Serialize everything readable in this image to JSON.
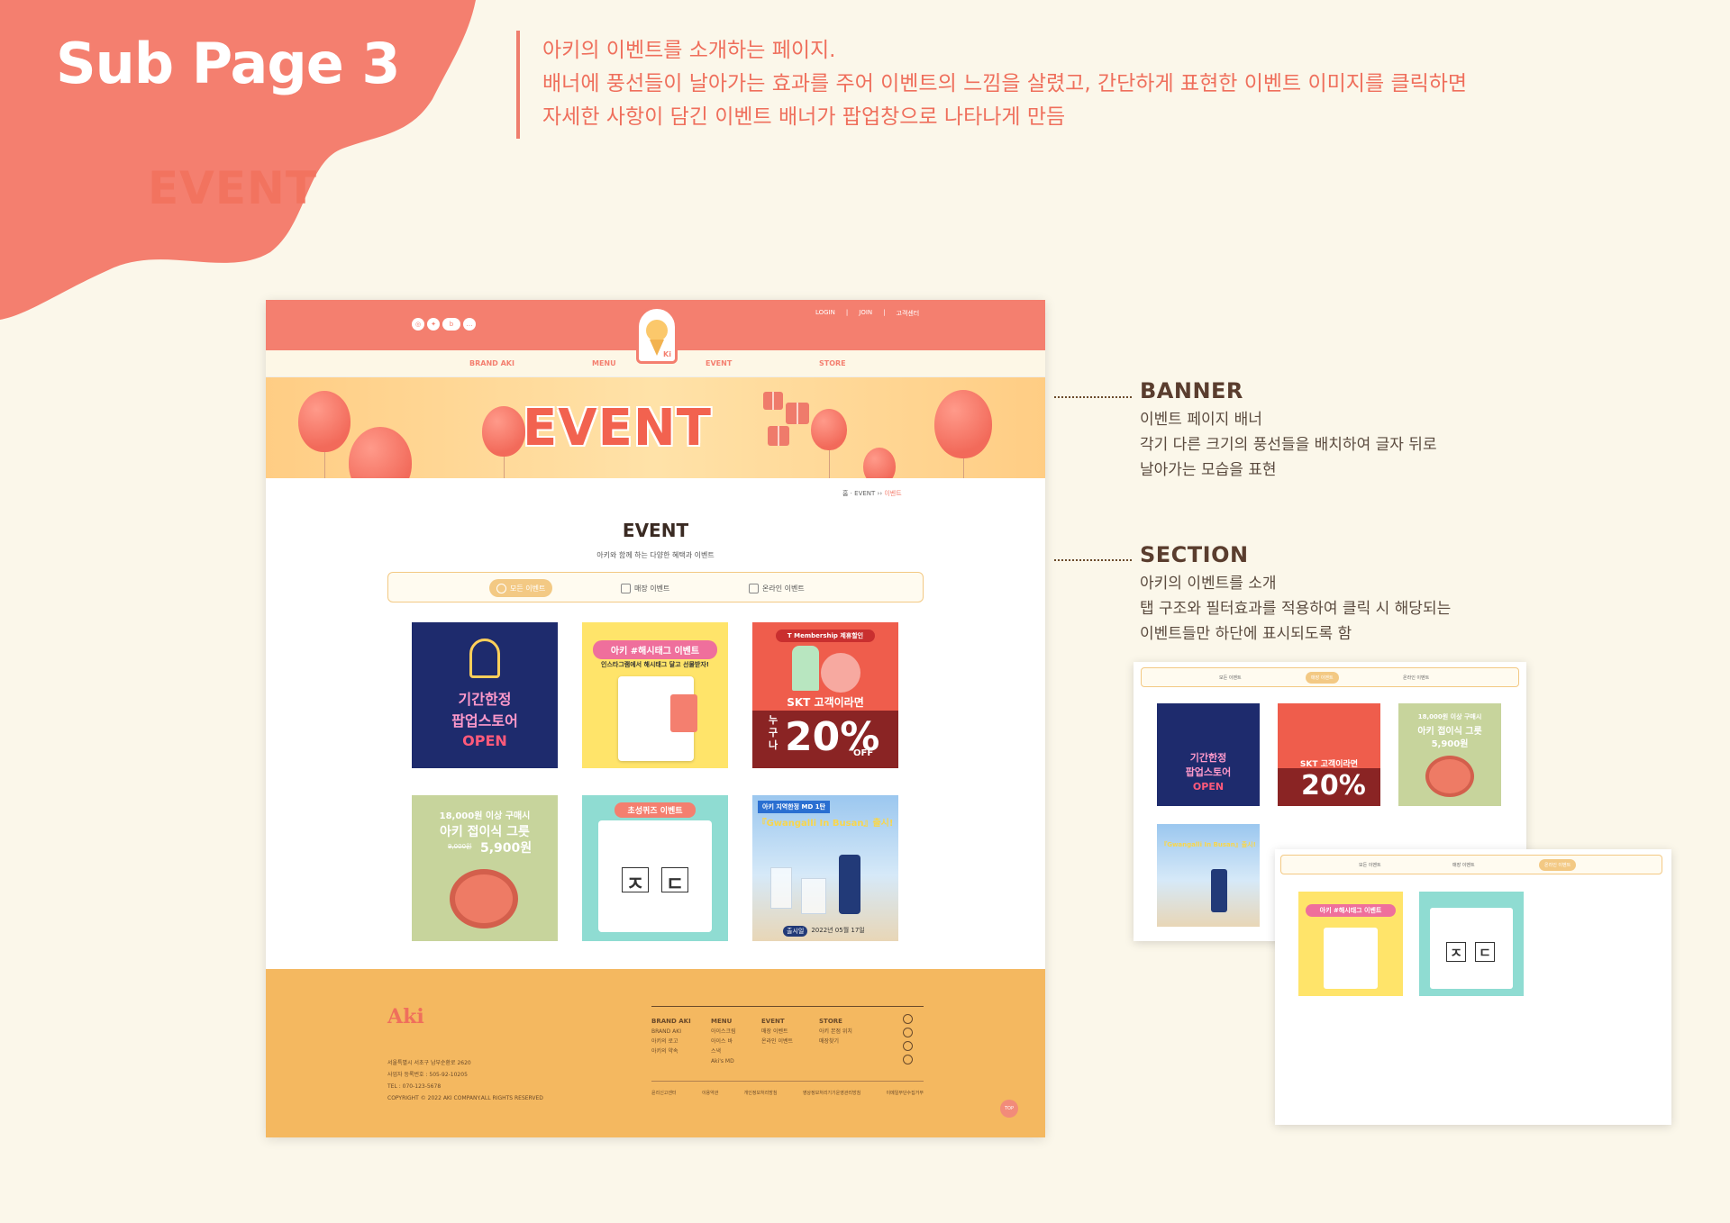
{
  "header": {
    "sub_title": "Sub Page 3",
    "page_name": "EVENT",
    "description": [
      "아키의 이벤트를 소개하는 페이지.",
      "배너에 풍선들이 날아가는 효과를 주어 이벤트의 느낌을 살렸고, 간단하게 표현한 이벤트 이미지를 클릭하면",
      "자세한 사항이 담긴 이벤트 배너가 팝업창으로 나타나게 만듬"
    ]
  },
  "site": {
    "util_links": [
      "LOGIN",
      "JOIN",
      "고객센터"
    ],
    "nav": [
      "BRAND AKI",
      "MENU",
      "EVENT",
      "STORE"
    ],
    "banner_title": "EVENT",
    "breadcrumb": {
      "home": "홈",
      "section": "EVENT",
      "current": "이벤트"
    },
    "section_title": "EVENT",
    "section_subtitle": "아키와 함께 하는 다양한 혜택과 이벤트",
    "tabs": [
      "모든 이벤트",
      "매장 이벤트",
      "온라인 이벤트"
    ],
    "cards": {
      "popup": {
        "line1": "기간한정",
        "line2": "팝업스토어",
        "line3": "OPEN"
      },
      "hashtag": {
        "title": "아키 #해시태그 이벤트",
        "sub": "인스타그램에서 해시태그 달고 선물받자!"
      },
      "skt": {
        "badge": "T Membership 제휴할인",
        "line": "SKT 고객이라면",
        "side": "누구나",
        "pct": "20%",
        "off": "OFF"
      },
      "bowl": {
        "line1": "18,000원 이상 구매시",
        "line2": "아키 접이식 그릇",
        "old": "9,000원",
        "price": "5,900원"
      },
      "choseong": {
        "title": "초성퀴즈 이벤트",
        "answer1": "ㅈ",
        "answer2": "ㄷ"
      },
      "busan": {
        "tag": "아키 지역한정 MD 1탄",
        "title": "『Gwangalli In Busan』출시!",
        "date_label": "출시일",
        "date": "2022년 05월 17일"
      }
    },
    "footer": {
      "logo": "Aki",
      "address": [
        "서울특별시 서초구 남부순환로 2620",
        "사업자 등록번호 : 505-92-10205",
        "TEL : 070-123-5678",
        "COPYRIGHT © 2022 AKI COMPANY.ALL RIGHTS RESERVED"
      ],
      "columns": [
        {
          "title": "BRAND AKI",
          "items": [
            "BRAND AKI",
            "아키의 로고",
            "아키의 약속"
          ]
        },
        {
          "title": "MENU",
          "items": [
            "아이스크림",
            "아이스 바",
            "스낵",
            "Aki's MD"
          ]
        },
        {
          "title": "EVENT",
          "items": [
            "매장 이벤트",
            "온라인 이벤트"
          ]
        },
        {
          "title": "STORE",
          "items": [
            "아키 본점 위치",
            "매장찾기"
          ]
        }
      ],
      "links": [
        "윤리신고센터",
        "이용약관",
        "개인정보처리방침",
        "영상정보처리기기운영관리방침",
        "이메일무단수집거부"
      ],
      "top": "TOP"
    }
  },
  "annotations": {
    "banner": {
      "title": "BANNER",
      "lines": [
        "이벤트 페이지 배너",
        "각기 다른 크기의 풍선들을 배치하여 글자 뒤로",
        "날아가는 모습을 표현"
      ]
    },
    "section": {
      "title": "SECTION",
      "lines": [
        "아키의 이벤트를 소개",
        "탭 구조와 필터효과를 적용하여 클릭 시 해당되는",
        "이벤트들만 하단에 표시되도록 함"
      ]
    }
  },
  "colors": {
    "accent": "#f47f6f",
    "background": "#fbf7ea",
    "banner": "#ffcd84",
    "footer": "#f4b860"
  }
}
